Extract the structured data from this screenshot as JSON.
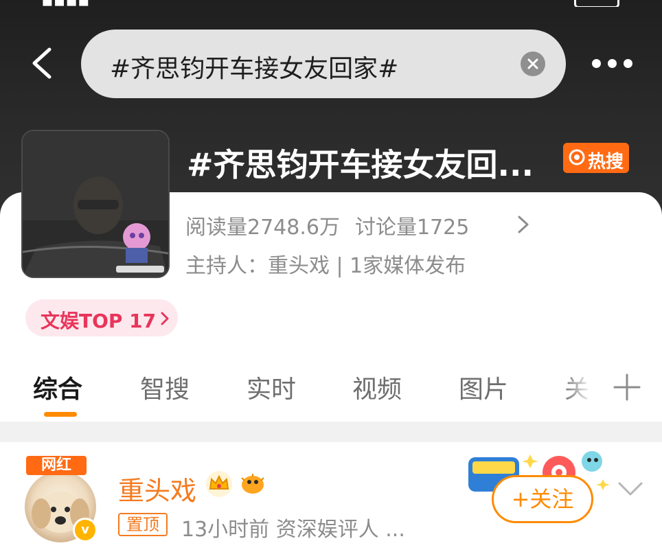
{
  "search": {
    "query": "#齐思钧开车接女友回家#"
  },
  "topic": {
    "title": "#齐思钧开车接女友回...",
    "hot_badge": "热搜",
    "reads_label": "阅读量2748.6万",
    "discussions_label": "讨论量1725",
    "host_line": "主持人：重头戏 | 1家媒体发布",
    "rank_label": "文娱TOP 17"
  },
  "tabs": [
    {
      "label": "综合",
      "active": true
    },
    {
      "label": "智搜"
    },
    {
      "label": "实时"
    },
    {
      "label": "视频"
    },
    {
      "label": "图片"
    },
    {
      "label": "关"
    }
  ],
  "post": {
    "author_badge": "网红",
    "author": "重头戏",
    "verified_mark": "v",
    "pinned": "置顶",
    "meta": "13小时前  资深娱评人 ...",
    "follow_label": "+关注"
  },
  "colors": {
    "accent": "#ff8a00",
    "hot": "#ff6a13",
    "rank": "#e8355a"
  }
}
